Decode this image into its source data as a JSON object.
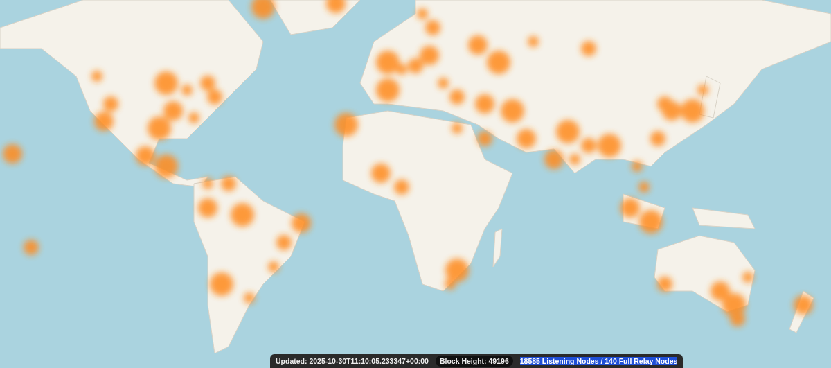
{
  "status_bar": {
    "items": [
      {
        "text": "Updated: 2025-10-30T11:10:05.233347+00:00",
        "kind": "plain",
        "highlighted": false
      },
      {
        "text": "Block Height: 49196",
        "kind": "pill",
        "highlighted": false
      },
      {
        "text": "18585 Listening Nodes / 140 Full Relay Nodes",
        "kind": "plain",
        "highlighted": true
      }
    ]
  }
}
